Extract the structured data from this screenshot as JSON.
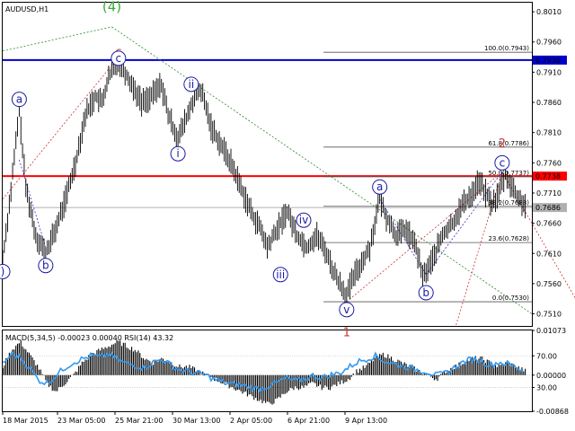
{
  "chart_data": [
    {
      "type": "candlestick",
      "title": "AUDUSD,H1",
      "ylim": [
        0.749,
        0.8025
      ],
      "ytick_labels": [
        "0.8010",
        "0.7960",
        "0.7910",
        "0.7860",
        "0.7810",
        "0.7760",
        "0.7710",
        "0.7660",
        "0.7610",
        "0.7560",
        "0.7510"
      ],
      "xtick_labels": [
        "18 Mar 2015",
        "23 Mar 05:00",
        "25 Mar 21:00",
        "30 Mar 13:00",
        "2 Apr 05:00",
        "6 Apr 21:00",
        "9 Apr 13:00"
      ],
      "price_series": [
        [
          0,
          0.76
        ],
        [
          2,
          0.769
        ],
        [
          5,
          0.7845
        ],
        [
          7,
          0.772
        ],
        [
          10,
          0.764
        ],
        [
          13,
          0.761
        ],
        [
          16,
          0.765
        ],
        [
          19,
          0.77
        ],
        [
          22,
          0.776
        ],
        [
          25,
          0.784
        ],
        [
          28,
          0.787
        ],
        [
          30,
          0.786
        ],
        [
          32,
          0.79
        ],
        [
          35,
          0.793
        ],
        [
          38,
          0.79
        ],
        [
          40,
          0.788
        ],
        [
          42,
          0.786
        ],
        [
          45,
          0.787
        ],
        [
          48,
          0.789
        ],
        [
          50,
          0.784
        ],
        [
          53,
          0.78
        ],
        [
          56,
          0.784
        ],
        [
          58,
          0.787
        ],
        [
          60,
          0.788
        ],
        [
          63,
          0.782
        ],
        [
          66,
          0.779
        ],
        [
          69,
          0.776
        ],
        [
          72,
          0.772
        ],
        [
          75,
          0.768
        ],
        [
          78,
          0.765
        ],
        [
          80,
          0.762
        ],
        [
          83,
          0.765
        ],
        [
          86,
          0.768
        ],
        [
          89,
          0.764
        ],
        [
          92,
          0.762
        ],
        [
          95,
          0.764
        ],
        [
          98,
          0.761
        ],
        [
          100,
          0.758
        ],
        [
          102,
          0.756
        ],
        [
          104,
          0.754
        ],
        [
          106,
          0.757
        ],
        [
          108,
          0.759
        ],
        [
          111,
          0.762
        ],
        [
          114,
          0.77
        ],
        [
          116,
          0.767
        ],
        [
          119,
          0.764
        ],
        [
          122,
          0.765
        ],
        [
          125,
          0.762
        ],
        [
          127,
          0.757
        ],
        [
          130,
          0.76
        ],
        [
          133,
          0.764
        ],
        [
          136,
          0.766
        ],
        [
          139,
          0.769
        ],
        [
          142,
          0.771
        ],
        [
          144,
          0.773
        ],
        [
          146,
          0.771
        ],
        [
          148,
          0.769
        ],
        [
          150,
          0.771
        ],
        [
          152,
          0.774
        ],
        [
          154,
          0.772
        ],
        [
          156,
          0.77
        ],
        [
          158,
          0.769
        ]
      ],
      "horizontal_lines": [
        {
          "price": 0.793,
          "label": "0.7930",
          "color": "#0000cc"
        },
        {
          "price": 0.7738,
          "label": "0.7738",
          "color": "#ff0000"
        },
        {
          "price": 0.7686,
          "label": "0.7686",
          "color": "#b0b0b0"
        }
      ],
      "fibonacci": [
        {
          "label": "100.0(0.7943)",
          "price": 0.7943
        },
        {
          "label": "61.8(0.7786)",
          "price": 0.7786
        },
        {
          "label": "50.0(0.7737)",
          "price": 0.7737
        },
        {
          "label": "38.2(0.7688)",
          "price": 0.7688
        },
        {
          "label": "23.6(0.7628)",
          "price": 0.7628
        },
        {
          "label": "0.0(0.7530)",
          "price": 0.753
        }
      ],
      "wave_labels": [
        {
          "text": "(4)",
          "t": 33,
          "price": 0.8018,
          "color": "#3aa83a",
          "circle": false
        },
        {
          "text": "c",
          "t": 35,
          "price": 0.7945,
          "color": "#cc3333",
          "circle": false
        },
        {
          "text": "c",
          "t": 35,
          "price": 0.7933,
          "color": "#1a1aa8",
          "circle": true
        },
        {
          "text": "a",
          "t": 5,
          "price": 0.7865,
          "color": "#1a1aa8",
          "circle": true
        },
        {
          "text": "b",
          "t": 13,
          "price": 0.759,
          "color": "#1a1aa8",
          "circle": true
        },
        {
          "text": "ii",
          "t": 57,
          "price": 0.789,
          "color": "#1a1aa8",
          "circle": true
        },
        {
          "text": "i",
          "t": 53,
          "price": 0.7775,
          "color": "#1a1aa8",
          "circle": true
        },
        {
          "text": "iv",
          "t": 91,
          "price": 0.7665,
          "color": "#1a1aa8",
          "circle": true
        },
        {
          "text": "iii",
          "t": 84,
          "price": 0.7575,
          "color": "#1a1aa8",
          "circle": true
        },
        {
          "text": "v",
          "t": 104,
          "price": 0.7517,
          "color": "#1a1aa8",
          "circle": true
        },
        {
          "text": "1",
          "t": 104,
          "price": 0.748,
          "color": "#cc3333",
          "circle": false
        },
        {
          "text": "a",
          "t": 114,
          "price": 0.772,
          "color": "#1a1aa8",
          "circle": true
        },
        {
          "text": "b",
          "t": 128,
          "price": 0.7545,
          "color": "#1a1aa8",
          "circle": true
        },
        {
          "text": "2",
          "t": 151,
          "price": 0.7793,
          "color": "#cc3333",
          "circle": false
        },
        {
          "text": "c",
          "t": 151,
          "price": 0.776,
          "color": "#1a1aa8",
          "circle": true
        },
        {
          "text": ")",
          "t": 0,
          "price": 0.758,
          "color": "#1a1aa8",
          "circle": true
        }
      ]
    },
    {
      "type": "line",
      "title": "MACD(5,34,5) -0.00023 0.00040 RSI(14) 43.32",
      "ylim": [
        -0.00868,
        0.01073
      ],
      "ytick_labels": [
        "0.01073",
        "70.00",
        "0.00000",
        "30.00",
        "-0.00868"
      ],
      "macd_histogram": [
        0.002,
        0.006,
        0.008,
        0.005,
        0.002,
        -0.002,
        -0.004,
        -0.002,
        0.0,
        0.003,
        0.005,
        0.006,
        0.007,
        0.008,
        0.007,
        0.006,
        0.004,
        0.003,
        0.004,
        0.003,
        0.002,
        0.002,
        0.001,
        0.0,
        -0.001,
        -0.002,
        -0.003,
        -0.004,
        -0.005,
        -0.006,
        -0.007,
        -0.006,
        -0.004,
        -0.003,
        -0.003,
        -0.002,
        -0.003,
        -0.003,
        -0.002,
        -0.001,
        0.001,
        0.002,
        0.004,
        0.005,
        0.004,
        0.003,
        0.002,
        0.001,
        0.0,
        -0.001,
        0.001,
        0.002,
        0.003,
        0.004,
        0.004,
        0.003,
        0.002,
        0.003,
        0.002,
        0.001
      ],
      "rsi": [
        60,
        72,
        68,
        55,
        40,
        35,
        45,
        55,
        62,
        66,
        70,
        68,
        72,
        65,
        60,
        58,
        55,
        62,
        66,
        58,
        52,
        50,
        48,
        45,
        40,
        36,
        34,
        33,
        30,
        28,
        32,
        36,
        42,
        38,
        40,
        45,
        42,
        46,
        48,
        55,
        62,
        66,
        70,
        64,
        60,
        58,
        55,
        52,
        50,
        45,
        48,
        55,
        62,
        66,
        64,
        58,
        62,
        60,
        55,
        50
      ]
    }
  ]
}
